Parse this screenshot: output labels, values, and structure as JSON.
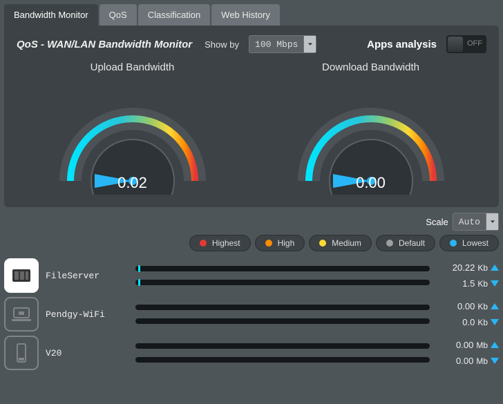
{
  "tabs": [
    {
      "label": "Bandwidth Monitor",
      "active": true
    },
    {
      "label": "QoS",
      "active": false
    },
    {
      "label": "Classification",
      "active": false
    },
    {
      "label": "Web History",
      "active": false
    }
  ],
  "title": "QoS - WAN/LAN Bandwidth Monitor",
  "show_by_label": "Show by",
  "show_by_value": "100 Mbps",
  "apps_analysis_label": "Apps analysis",
  "apps_analysis_state": "OFF",
  "gauges": {
    "upload": {
      "title": "Upload Bandwidth",
      "value": "0.02"
    },
    "download": {
      "title": "Download Bandwidth",
      "value": "0.00"
    }
  },
  "scale_label": "Scale",
  "scale_value": "Auto",
  "legend": [
    {
      "label": "Highest",
      "color": "#e53935"
    },
    {
      "label": "High",
      "color": "#fb8c00"
    },
    {
      "label": "Medium",
      "color": "#fdd835"
    },
    {
      "label": "Default",
      "color": "#9e9e9e"
    },
    {
      "label": "Lowest",
      "color": "#29b6f6"
    }
  ],
  "devices": [
    {
      "name": "FileServer",
      "icon": "nas",
      "selected": true,
      "up": {
        "value": "20.22",
        "unit": "Kb"
      },
      "down": {
        "value": "1.5",
        "unit": "Kb"
      },
      "up_tick_pct": 1,
      "down_tick_pct": 1
    },
    {
      "name": "Pendgy-WiFi",
      "icon": "laptop",
      "selected": false,
      "up": {
        "value": "0.00",
        "unit": "Kb"
      },
      "down": {
        "value": "0.0",
        "unit": "Kb"
      },
      "up_tick_pct": 0,
      "down_tick_pct": 0
    },
    {
      "name": "V20",
      "icon": "phone",
      "selected": false,
      "up": {
        "value": "0.00",
        "unit": "Mb"
      },
      "down": {
        "value": "0.00",
        "unit": "Mb"
      },
      "up_tick_pct": 0,
      "down_tick_pct": 0
    }
  ]
}
